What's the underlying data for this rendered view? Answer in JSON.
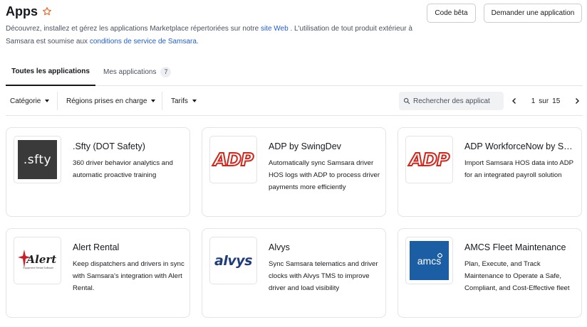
{
  "header": {
    "title": "Apps",
    "desc_part1": "Découvrez, installez et gérez les applications Marketplace répertoriées sur notre ",
    "desc_link1": "site Web",
    "desc_part2": " . L'utilisation de tout produit extérieur à Samsara est soumise aux ",
    "desc_link2": "conditions de service de Samsara",
    "desc_part3": ".",
    "buttons": {
      "beta": "Code bêta",
      "request": "Demander une application"
    }
  },
  "tabs": {
    "all": "Toutes les applications",
    "mine": "Mes applications",
    "mine_count": "7"
  },
  "filters": {
    "category": "Catégorie",
    "regions": "Régions prises en charge",
    "pricing": "Tarifs"
  },
  "search": {
    "placeholder": "Rechercher des applicat"
  },
  "pager": {
    "current": "1",
    "of": "sur",
    "total": "15"
  },
  "colors": {
    "accent_link": "#1f5fd1",
    "star": "#e06a2c",
    "adp_red": "#d0261c",
    "alvys_blue": "#1f3d7a",
    "amcs_blue": "#1b5ea3",
    "sfty_bg": "#3a3a3a"
  },
  "apps": [
    {
      "name": ".Sfty (DOT Safety)",
      "desc": "360 driver behavior analytics and automatic proactive training",
      "logo_icon": "sfty-logo",
      "logo_text": ".sfty"
    },
    {
      "name": "ADP by SwingDev",
      "desc": "Automatically sync Samsara driver HOS logs with ADP to process driver payments more efficiently",
      "logo_icon": "adp-logo",
      "logo_text": "ADP"
    },
    {
      "name": "ADP WorkforceNow by Samsara",
      "desc": "Import Samsara HOS data into ADP for an integrated payroll solution",
      "logo_icon": "adp-logo",
      "logo_text": "ADP"
    },
    {
      "name": "Alert Rental",
      "desc": "Keep dispatchers and drivers in sync with Samsara's integration with Alert Rental.",
      "logo_icon": "alert-logo",
      "logo_text": "Alert",
      "logo_subtext": "Equipment Rental Software"
    },
    {
      "name": "Alvys",
      "desc": "Sync Samsara telematics and driver clocks with Alvys TMS to improve driver and load visibility",
      "logo_icon": "alvys-logo",
      "logo_text": "alvys"
    },
    {
      "name": "AMCS Fleet Maintenance",
      "desc": "Plan, Execute, and Track Maintenance to Operate a Safe, Compliant, and Cost-Effective fleet",
      "logo_icon": "amcs-logo",
      "logo_text": "amcs"
    }
  ]
}
